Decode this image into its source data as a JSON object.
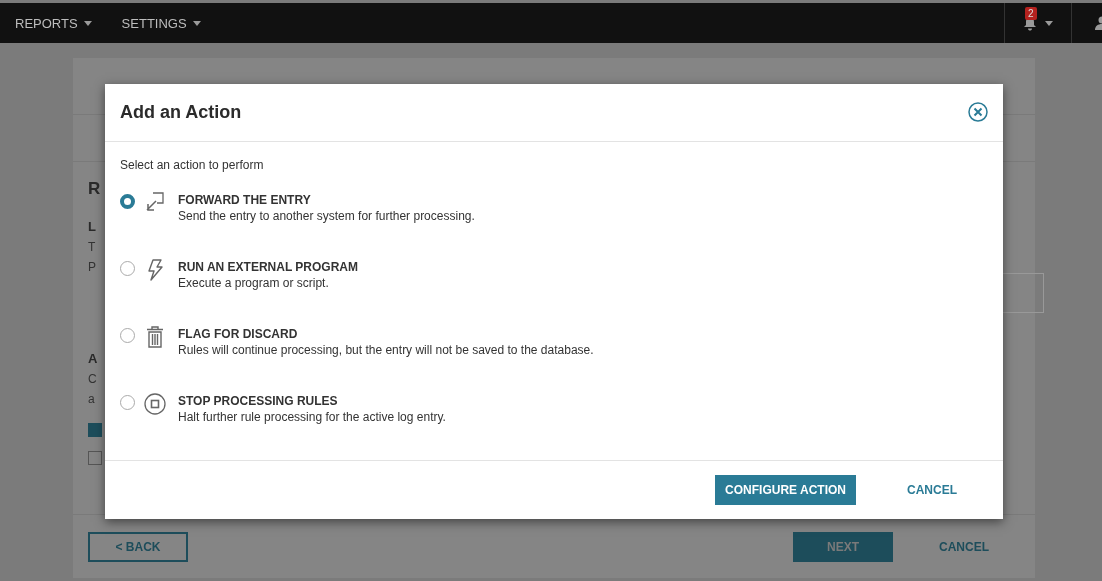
{
  "nav": {
    "menus": [
      {
        "label": "REPORTS"
      },
      {
        "label": "SETTINGS"
      }
    ],
    "notifications": {
      "count": "2"
    }
  },
  "page": {
    "section_heading": "R",
    "fragments_top": [
      {
        "text": "L",
        "kind": "heading"
      },
      {
        "text": "T",
        "kind": "text"
      },
      {
        "text": "P",
        "kind": "text"
      }
    ],
    "fragments_bottom": [
      {
        "text": "A",
        "kind": "heading"
      },
      {
        "text": "C",
        "kind": "text"
      },
      {
        "text": "a",
        "kind": "text"
      }
    ],
    "checkboxes": [
      {
        "checked": true
      },
      {
        "checked": false
      }
    ],
    "footer": {
      "back": "< BACK",
      "next": "NEXT",
      "cancel": "CANCEL"
    }
  },
  "dialog": {
    "title": "Add an Action",
    "prompt": "Select an action to perform",
    "options": [
      {
        "kind": "forward",
        "title": "FORWARD THE ENTRY",
        "description": "Send the entry to another system for further processing.",
        "selected": true
      },
      {
        "kind": "run",
        "title": "RUN AN EXTERNAL PROGRAM",
        "description": "Execute a program or script.",
        "selected": false
      },
      {
        "kind": "discard",
        "title": "FLAG FOR DISCARD",
        "description": "Rules will continue processing, but the entry will not be saved to the database.",
        "selected": false
      },
      {
        "kind": "stop",
        "title": "STOP PROCESSING RULES",
        "description": "Halt further rule processing for the active log entry.",
        "selected": false
      }
    ],
    "primary": "CONFIGURE ACTION",
    "cancel": "CANCEL"
  }
}
